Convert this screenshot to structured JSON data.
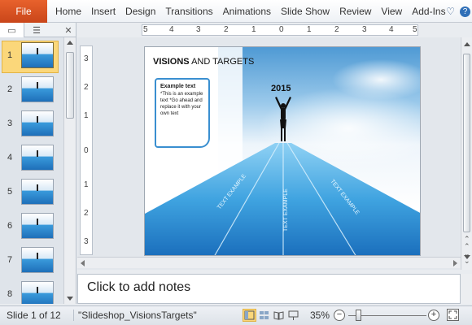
{
  "ribbon": {
    "file_label": "File",
    "tabs": [
      "Home",
      "Insert",
      "Design",
      "Transitions",
      "Animations",
      "Slide Show",
      "Review",
      "View",
      "Add-Ins"
    ]
  },
  "thumbnails_pane": {
    "slides": [
      {
        "number": "1",
        "selected": true
      },
      {
        "number": "2",
        "selected": false
      },
      {
        "number": "3",
        "selected": false
      },
      {
        "number": "4",
        "selected": false
      },
      {
        "number": "5",
        "selected": false
      },
      {
        "number": "6",
        "selected": false
      },
      {
        "number": "7",
        "selected": false
      },
      {
        "number": "8",
        "selected": false
      }
    ]
  },
  "ruler": {
    "horizontal_labels": [
      "5",
      "4",
      "3",
      "2",
      "1",
      "0",
      "1",
      "2",
      "3",
      "4",
      "5"
    ],
    "vertical_labels": [
      "3",
      "2",
      "1",
      "0",
      "1",
      "2",
      "3"
    ]
  },
  "slide": {
    "title_bold": "VISIONS",
    "title_rest": " AND TARGETS",
    "callout_title": "Example text",
    "callout_body": "*This is an example text *Go ahead and replace it with your own text",
    "year": "2015",
    "path_labels": [
      "TEXT EXAMPLE",
      "TEXT EXAMPLE",
      "TEXT EXAMPLE"
    ],
    "colors": {
      "sky": "#5fa8dc",
      "road_light": "#7fc6f0",
      "road_dark": "#1f7ec9",
      "accent": "#3a8fd0"
    }
  },
  "notes": {
    "placeholder": "Click to add notes"
  },
  "status_bar": {
    "slide_indicator": "Slide 1 of 12",
    "theme_name": "\"Slideshop_VisionsTargets\"",
    "zoom": "35%",
    "zoom_out": "−",
    "zoom_in": "+"
  }
}
